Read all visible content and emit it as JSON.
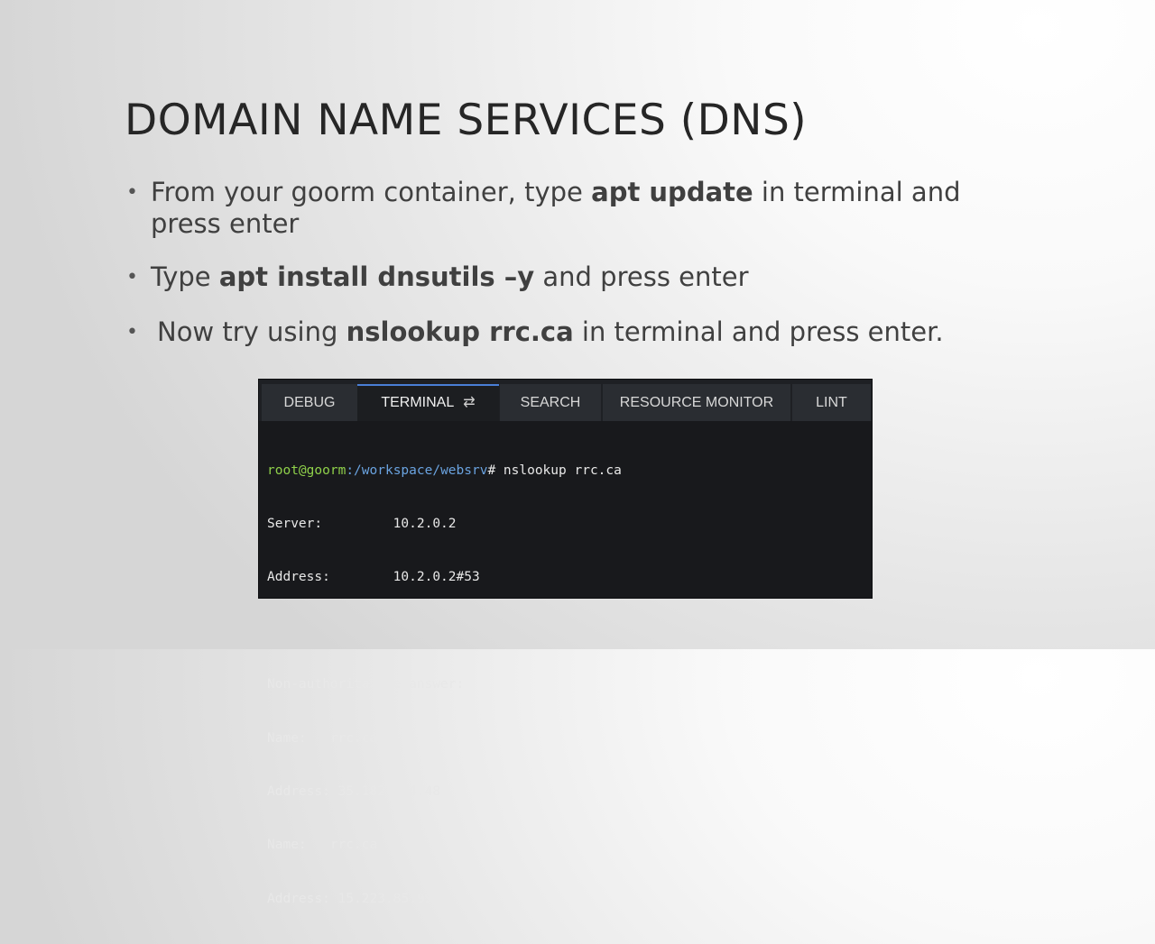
{
  "slide": {
    "title": "DOMAIN NAME SERVICES (DNS)",
    "bullet_char": "•",
    "bullets": [
      {
        "before": "From your goorm container, type ",
        "bold": "apt update",
        "after": " in terminal and press enter"
      },
      {
        "before": "Type ",
        "bold": "apt install dnsutils –y",
        "after": " and press enter"
      },
      {
        "before": "Now try using ",
        "bold": "nslookup rrc.ca",
        "after": " in terminal and press enter."
      }
    ]
  },
  "terminal": {
    "tabs": [
      {
        "label": "DEBUG"
      },
      {
        "label": "TERMINAL",
        "active": true,
        "icon": "refresh-icon"
      },
      {
        "label": "SEARCH"
      },
      {
        "label": "RESOURCE MONITOR"
      },
      {
        "label": "LINT"
      }
    ],
    "tab_icon_glyph": "⇄",
    "prompt": {
      "user": "root@goorm",
      "path": ":/workspace/websrv",
      "command": "# nslookup rrc.ca"
    },
    "output": [
      "Server:         10.2.0.2",
      "Address:        10.2.0.2#53",
      "",
      "Non-authoritative answer:",
      "Name:   rrc.ca",
      "Address: 35.182.194.48",
      "Name:   rrc.ca",
      "Address: 15.223.85.99"
    ]
  },
  "colors": {
    "prompt_user": "#8fd14a",
    "prompt_path": "#6aa3e0",
    "active_tab_accent": "#4a7fd6",
    "terminal_bg": "#18191c"
  }
}
